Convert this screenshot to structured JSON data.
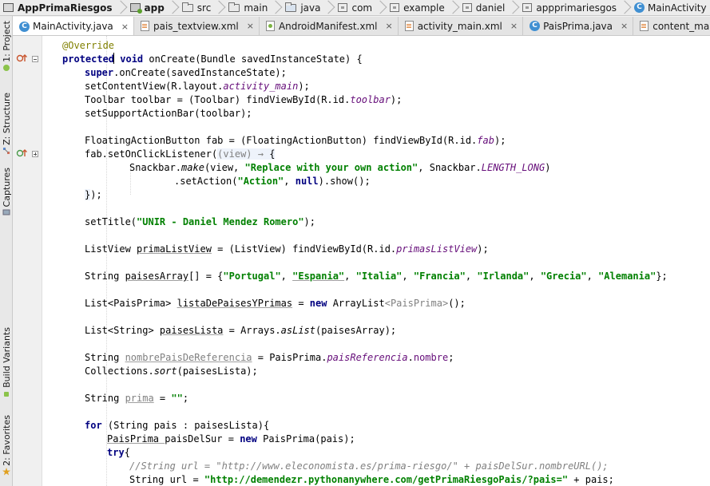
{
  "breadcrumb": [
    {
      "label": "AppPrimaRiesgos",
      "icon": "project-icon"
    },
    {
      "label": "app",
      "icon": "module-icon"
    },
    {
      "label": "src",
      "icon": "folder-icon"
    },
    {
      "label": "main",
      "icon": "folder-icon"
    },
    {
      "label": "java",
      "icon": "source-folder-icon"
    },
    {
      "label": "com",
      "icon": "package-icon"
    },
    {
      "label": "example",
      "icon": "package-icon"
    },
    {
      "label": "daniel",
      "icon": "package-icon"
    },
    {
      "label": "appprimariesgos",
      "icon": "package-icon"
    },
    {
      "label": "MainActivity",
      "icon": "class-icon"
    }
  ],
  "left_panel": {
    "project": "1: Project",
    "structure": "Z: Structure",
    "captures": "Captures",
    "build_variants": "Build Variants",
    "favorites": "2: Favorites"
  },
  "tabs": [
    {
      "label": "MainActivity.java",
      "icon": "class-icon",
      "close": "×"
    },
    {
      "label": "pais_textview.xml",
      "icon": "xml-file-icon",
      "close": "×"
    },
    {
      "label": "AndroidManifest.xml",
      "icon": "manifest-file-icon",
      "close": "×"
    },
    {
      "label": "activity_main.xml",
      "icon": "xml-file-icon",
      "close": "×"
    },
    {
      "label": "PaisPrima.java",
      "icon": "class-icon",
      "close": "×"
    },
    {
      "label": "content_main.xml",
      "icon": "xml-file-icon",
      "close": "×"
    }
  ],
  "class_icon_letter": "C",
  "colors": {
    "keyword": "#000080",
    "string": "#008000",
    "field": "#660e7a",
    "annotation": "#808000",
    "comment": "#808080"
  },
  "code": {
    "l1": [
      "@Override"
    ],
    "l2": [
      "protected",
      " void ",
      "onCreate(Bundle savedInstanceState) {"
    ],
    "l3": [
      "super",
      ".onCreate(savedInstanceState);"
    ],
    "l4": [
      "setContentView(R.layout.",
      "activity_main",
      ");"
    ],
    "l5": [
      "Toolbar toolbar = (Toolbar) findViewById(R.id.",
      "toolbar",
      ");"
    ],
    "l6": [
      "setSupportActionBar(toolbar);"
    ],
    "l7": [
      "FloatingActionButton fab = (FloatingActionButton) findViewById(R.id.",
      "fab",
      ");"
    ],
    "l8": [
      "fab.setOnClickListener(",
      "(view) ",
      "→",
      " {"
    ],
    "l9": [
      "Snackbar.",
      "make",
      "(view, ",
      "\"Replace with your own action\"",
      ", Snackbar.",
      "LENGTH_LONG",
      ")"
    ],
    "l10": [
      ".setAction(",
      "\"Action\"",
      ", ",
      "null",
      ").show();"
    ],
    "l11": [
      "}",
      ");"
    ],
    "l12": [
      "setTitle(",
      "\"UNIR - Daniel Mendez Romero\"",
      ");"
    ],
    "l13": [
      "ListView ",
      "primaListView",
      " = (ListView) findViewById(R.id.",
      "primasListView",
      ");"
    ],
    "l14": [
      "String ",
      "paisesArray",
      "[] = {",
      "\"Portugal\"",
      ", ",
      "\"Espania\"",
      ", ",
      "\"Italia\"",
      ", ",
      "\"Francia\"",
      ", ",
      "\"Irlanda\"",
      ", ",
      "\"Grecia\"",
      ", ",
      "\"Alemania\"",
      "};"
    ],
    "l15": [
      "List<PaisPrima> ",
      "listaDePaisesYPrimas",
      " = ",
      "new",
      " ArrayList",
      "<PaisPrima>",
      "();"
    ],
    "l16": [
      "List<String> ",
      "paisesLista",
      " = Arrays.",
      "asList",
      "(paisesArray);"
    ],
    "l17": [
      "String ",
      "nombrePaisDeReferencia",
      " = PaisPrima.",
      "paisReferencia",
      ".",
      "nombre",
      ";"
    ],
    "l18": [
      "Collections.",
      "sort",
      "(paisesLista);"
    ],
    "l19": [
      "String ",
      "prima",
      " = ",
      "\"\"",
      ";"
    ],
    "l20": [
      "for",
      " (String pais : paisesLista){"
    ],
    "l21": [
      "PaisPrima ",
      "paisDelSur",
      " = ",
      "new",
      " PaisPrima(pais);"
    ],
    "l22": [
      "try",
      "{"
    ],
    "l23": [
      "//String url = \"http://www.eleconomista.es/prima-riesgo/\" + paisDelSur.nombreURL();"
    ],
    "l24": [
      "String url = ",
      "\"http://demendezr.pythonanywhere.com/getPrimaRiesgoPais/?pais=\"",
      " + pais;"
    ]
  }
}
